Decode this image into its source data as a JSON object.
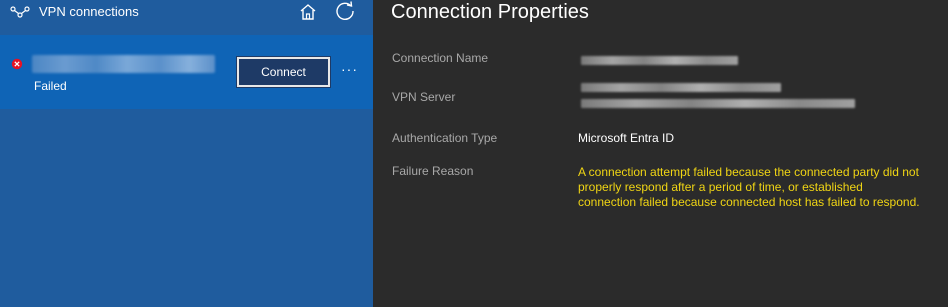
{
  "sidebar": {
    "title": "VPN connections",
    "icons": {
      "vpn": "vpn-icon",
      "home": "home-icon",
      "refresh": "refresh-icon"
    },
    "connection": {
      "status": "Failed",
      "connect_label": "Connect",
      "more_label": "···",
      "status_icon": "error-icon"
    }
  },
  "properties": {
    "title": "Connection Properties",
    "connection_name_label": "Connection Name",
    "vpn_server_label": "VPN Server",
    "auth_type_label": "Authentication Type",
    "auth_type_value": "Microsoft Entra ID",
    "failure_reason_label": "Failure Reason",
    "failure_reason_value": "A connection attempt failed because the connected party did not properly respond after a period of time, or established connection failed because connected host has failed to respond."
  },
  "colors": {
    "sidebar_bg": "#1f5c9e",
    "selected_item": "#0f64b6",
    "panel_bg": "#2b2b2b",
    "error": "#e81123",
    "failure_text": "#f0d514"
  }
}
